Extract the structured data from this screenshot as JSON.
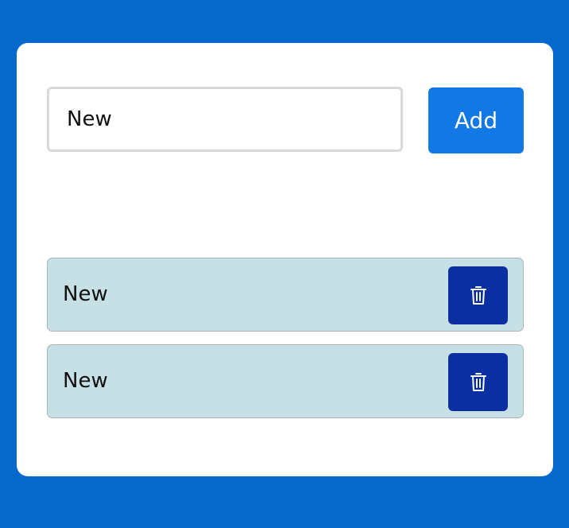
{
  "form": {
    "input_value": "New",
    "add_label": "Add"
  },
  "tasks": [
    {
      "text": "New",
      "delete_icon": "trash-icon"
    },
    {
      "text": "New",
      "delete_icon": "trash-icon"
    }
  ],
  "colors": {
    "background": "#0569cc",
    "card": "#ffffff",
    "add_button": "#1278e6",
    "task_item": "#c7e0e5",
    "delete_button": "#0b2ea1"
  }
}
